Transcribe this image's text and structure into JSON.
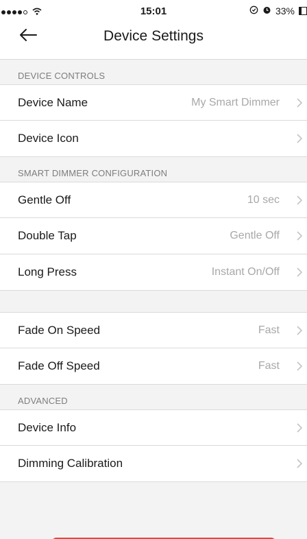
{
  "status_bar": {
    "time": "15:01",
    "battery": "33%",
    "battery_level": 0.33,
    "signal_bars": 4,
    "icons": [
      "signal-dots-icon",
      "wifi-icon",
      "location-icon",
      "alarm-icon",
      "battery-icon"
    ]
  },
  "nav": {
    "title": "Device Settings",
    "back_icon": "back-arrow-icon"
  },
  "sections": {
    "controls": {
      "header": "DEVICE CONTROLS",
      "rows": [
        {
          "label": "Device Name",
          "value": "My Smart Dimmer"
        },
        {
          "label": "Device Icon",
          "value": ""
        }
      ]
    },
    "config": {
      "header": "SMART DIMMER CONFIGURATION",
      "rows": [
        {
          "label": "Gentle Off",
          "value": "10 sec"
        },
        {
          "label": "Double Tap",
          "value": "Gentle Off"
        },
        {
          "label": "Long Press",
          "value": "Instant On/Off"
        }
      ]
    },
    "fade": {
      "rows": [
        {
          "label": "Fade On Speed",
          "value": "Fast"
        },
        {
          "label": "Fade Off Speed",
          "value": "Fast"
        }
      ]
    },
    "advanced": {
      "header": "ADVANCED",
      "rows": [
        {
          "label": "Device Info",
          "value": ""
        },
        {
          "label": "Dimming Calibration",
          "value": ""
        }
      ]
    }
  },
  "colors": {
    "background": "#f3f3f3",
    "row_background": "#ffffff",
    "value_text": "#a8a8a8",
    "header_text": "#7d7d7d",
    "danger_button": "#e8453c"
  }
}
